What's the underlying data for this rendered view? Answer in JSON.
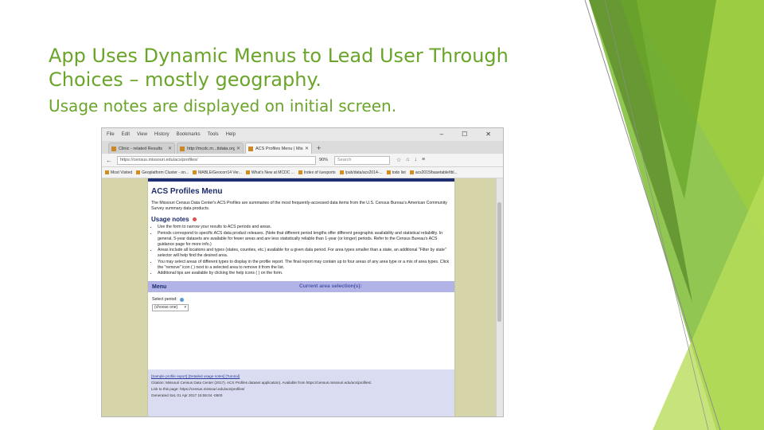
{
  "slide": {
    "title_line1": "App Uses Dynamic Menus to Lead User Through",
    "title_line2": "Choices – mostly geography.",
    "subtitle": "Usage notes are displayed on initial screen."
  },
  "colors": {
    "title": "#6aa52a",
    "page_header": "#1b2b6b",
    "menu_bar": "#b2b3e6",
    "footer": "#dadcf2",
    "page_bg": "#d6d4a9"
  },
  "browser": {
    "menu": [
      "File",
      "Edit",
      "View",
      "History",
      "Bookmarks",
      "Tools",
      "Help"
    ],
    "tabs": [
      {
        "label": "Clinic - related Results"
      },
      {
        "label": "http://mcdc.m...ttdata.org/"
      },
      {
        "label": "ACS Profiles Menu | Missouri C..."
      }
    ],
    "url": "https://census.missouri.edu/acs/profiles/",
    "zoom": "90%",
    "search_placeholder": "Search",
    "bookmarks": [
      "Most Visited",
      "Geoplatform Cluster - on...",
      "MABLE/Geocorr14 Ver...",
      "What's New at MCDC ...",
      "Index of /uexports",
      "/pub/data/acs2014-...",
      "todo list",
      "acs2015/basetable/tbl..."
    ]
  },
  "page": {
    "heading": "ACS Profiles Menu",
    "intro": "The Missouri Census Data Center's ACS Profiles are summaries of the most frequently-accessed data items from the U.S. Census Bureau's American Community Survey summary data products.",
    "usage_heading": "Usage notes",
    "notes": [
      "Use the form to narrow your results to ACS periods and areas.",
      "Periods correspond to specific ACS data product releases. (Note that different period lengths offer different geographic availability and statistical reliability. In general, 5-year datasets are available for fewer areas and are less statistically reliable than 1-year (or longer) periods. Refer to the Census Bureau's ACS guidance page for more info.)",
      "Areas include all locations and types (states, counties, etc.) available for a given data period. For area types smaller than a state, an additional \"Filter by state\" selector will help find the desired area.",
      "You may select areas of different types to display in the profile report. The final report may contain up to four areas of any area type or a mix of area types. Click the \"remove\" icon ( ) next to a selected area to remove it from the list.",
      "Additional tips are available by clicking the help icons ( ) on the form."
    ],
    "menu_label": "Menu",
    "current_selection": "Current area selection(s):",
    "select_period_label": "Select period:",
    "select_value": "(choose one)",
    "footer_line1": "[Sample profile report] [Detailed usage notes] [Tutorial]",
    "footer_line2": "Citation: Missouri Census Data Center (2017). ACS Profiles dataset application). Available from https://census.missouri.edu/acs/profiles/.",
    "footer_line3": "Link to this page: https://census.missouri.edu/acs/profiles/",
    "footer_line4": "Generated Sat, 01 Apr 2017 15:55:04 -0500"
  }
}
